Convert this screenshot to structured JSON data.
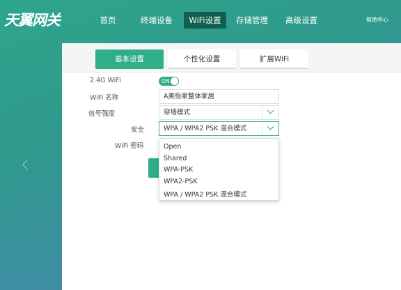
{
  "header": {
    "logo_text": "天翼网关",
    "nav": [
      "首页",
      "终端设备",
      "WiFi设置",
      "存储管理",
      "高级设置"
    ],
    "active_nav": "WiFi设置",
    "help": "帮助中心"
  },
  "tabs": [
    "基本设置",
    "个性化设置",
    "扩展WiFi"
  ],
  "active_tab": "基本设置",
  "form": {
    "band_label": "2.4G WiFi",
    "band_toggle": "ON",
    "ssid_label": "WiFi 名称",
    "ssid_value": "A美怡家整体家居",
    "signal_label": "信号强度",
    "signal_value": "穿墙模式",
    "security_label": "安全",
    "security_value": "WPA / WPA2 PSK 混合模式",
    "password_label": "WiFi 密码"
  },
  "security_options": [
    "Open",
    "Shared",
    "WPA-PSK",
    "WPA2-PSK",
    "WPA / WPA2 PSK 混合模式"
  ],
  "colors": {
    "accent": "#2fae8a",
    "active_nav_bg": "#0f5f50"
  }
}
